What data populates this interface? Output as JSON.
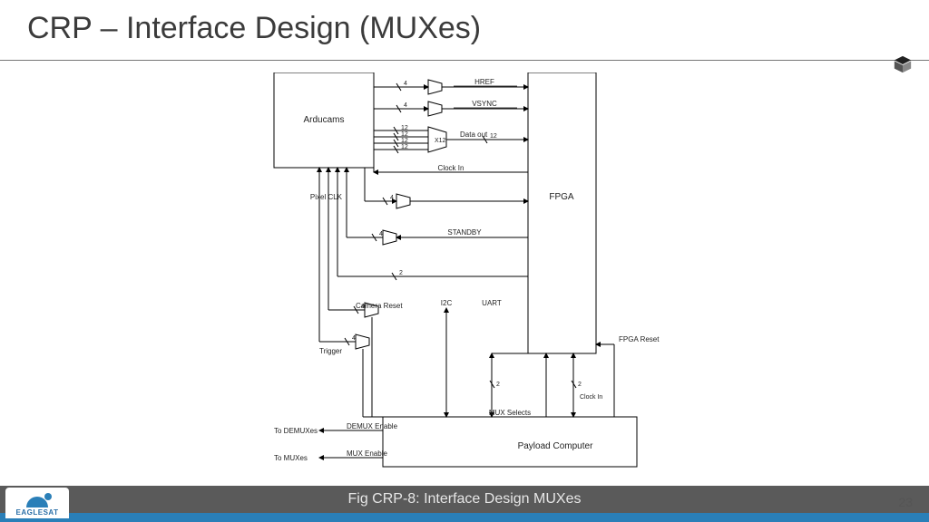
{
  "title": "CRP – Interface Design (MUXes)",
  "caption": "Fig CRP-8: Interface Design MUXes",
  "page_number": "23",
  "logo_text": "EAGLESAT",
  "blocks": {
    "arducams": "Arducams",
    "fpga": "FPGA",
    "payload": "Payload Computer"
  },
  "signals": {
    "href": "HREF",
    "vsync": "VSYNC",
    "data_out": "Data out",
    "clock_in": "Clock In",
    "pixel_clk": "Pixel CLK",
    "standby": "STANDBY",
    "camera_reset": "Camera Reset",
    "trigger": "Trigger",
    "i2c": "I2C",
    "uart": "UART",
    "fpga_reset": "FPGA Reset",
    "mux_selects": "MUX Selects",
    "demux_enable": "DEMUX Enable",
    "mux_enable": "MUX Enable",
    "to_demux": "To DEMUXes",
    "to_mux": "To MUXes",
    "mux_x12": "X12"
  },
  "bus_widths": {
    "w4": "4",
    "w12": "12",
    "w2": "2"
  }
}
